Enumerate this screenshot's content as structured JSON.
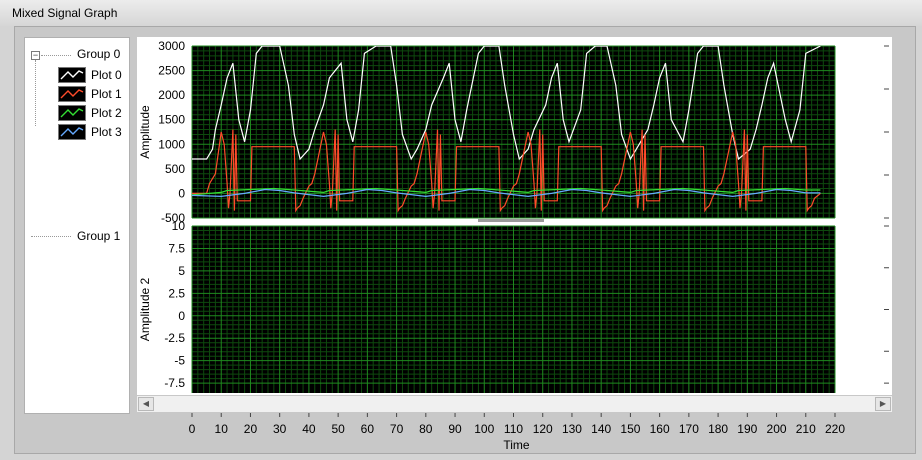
{
  "window": {
    "title": "Mixed Signal Graph"
  },
  "legend": {
    "expander_glyph": "−",
    "group0_label": "Group 0",
    "group1_label": "Group 1",
    "plots": [
      {
        "label": "Plot 0",
        "color": "#ffffff"
      },
      {
        "label": "Plot 1",
        "color": "#ff4b2a"
      },
      {
        "label": "Plot 2",
        "color": "#33dd33"
      },
      {
        "label": "Plot 3",
        "color": "#66aaff"
      }
    ]
  },
  "colors": {
    "plot_background": "#000000",
    "grid_major": "#1f8a1f",
    "grid_minor": "#0e4a0e"
  },
  "scrollbar": {
    "left_glyph": "◀",
    "right_glyph": "▶"
  },
  "chart_data": {
    "type": "line",
    "xlabel": "Time",
    "xlim": [
      0,
      220
    ],
    "xticks": [
      0,
      10,
      20,
      30,
      40,
      50,
      60,
      70,
      80,
      90,
      100,
      110,
      120,
      130,
      140,
      150,
      160,
      170,
      180,
      190,
      200,
      210,
      220
    ],
    "grid": true,
    "panels": [
      {
        "ylabel": "Amplitude",
        "ylim": [
          -500,
          3000
        ],
        "yticks": [
          3000,
          2500,
          2000,
          1500,
          1000,
          500,
          0,
          -500
        ],
        "period": 35,
        "series": [
          {
            "name": "Plot 0",
            "color": "#ffffff",
            "x": [
              0,
              5,
              7,
              8,
              10,
              12,
              14,
              16,
              18,
              20,
              22,
              24,
              28,
              30,
              33,
              35,
              37,
              40,
              42,
              45,
              47,
              51,
              53,
              55,
              57,
              59,
              63,
              65,
              68,
              70,
              72,
              75,
              77,
              80,
              82,
              86,
              88,
              90,
              92,
              94,
              98,
              100,
              103,
              105,
              107,
              110,
              112,
              115,
              117,
              121,
              123,
              125,
              127,
              129,
              133,
              135,
              138,
              140,
              142,
              145,
              147,
              150,
              152,
              156,
              158,
              160,
              162,
              164,
              168,
              170,
              173,
              175,
              177,
              180,
              182,
              185,
              187,
              191,
              193,
              195,
              197,
              199,
              203,
              205,
              208,
              210,
              215
            ],
            "y": [
              700,
              700,
              900,
              1300,
              1800,
              2350,
              2650,
              1500,
              1050,
              1700,
              2850,
              3000,
              3000,
              3000,
              2200,
              1200,
              700,
              900,
              1300,
              1800,
              2350,
              2650,
              1500,
              1050,
              1700,
              2850,
              3000,
              3000,
              3000,
              2200,
              1200,
              700,
              900,
              1300,
              1800,
              2350,
              2650,
              1500,
              1050,
              1700,
              2850,
              3000,
              3000,
              3000,
              2200,
              1200,
              700,
              900,
              1300,
              1800,
              2350,
              2650,
              1500,
              1050,
              1700,
              2850,
              3000,
              3000,
              3000,
              2200,
              1200,
              700,
              900,
              1300,
              1800,
              2350,
              2650,
              1500,
              1050,
              1700,
              2850,
              3000,
              3000,
              3000,
              2200,
              1200,
              700,
              900,
              1300,
              1800,
              2350,
              2650,
              1500,
              1050,
              1700,
              2850,
              3000,
              3000,
              3000,
              2200,
              1200,
              700,
              700
            ]
          },
          {
            "name": "Plot 1",
            "color": "#ff4b2a",
            "x": [
              0,
              5,
              6,
              8,
              10,
              11,
              12,
              12.5,
              13,
              14,
              14.5,
              15,
              15.5,
              20,
              20.5,
              35,
              35.5,
              36,
              37,
              38,
              40,
              41,
              42,
              45,
              46,
              47,
              47.5,
              48,
              49,
              49.5,
              50,
              50.5,
              55,
              55.5,
              70,
              70.5,
              71,
              72,
              73,
              75,
              76,
              77,
              80,
              81,
              82,
              82.5,
              83,
              84,
              84.5,
              85,
              85.5,
              90,
              90.5,
              105,
              105.5,
              106,
              107,
              108,
              110,
              111,
              112,
              115,
              116,
              117,
              117.5,
              118,
              119,
              119.5,
              120,
              120.5,
              125,
              125.5,
              140,
              140.5,
              141,
              142,
              143,
              145,
              146,
              147,
              150,
              151,
              152,
              152.5,
              153,
              154,
              154.5,
              155,
              155.5,
              160,
              160.5,
              175,
              175.5,
              176,
              177,
              178,
              180,
              181,
              182,
              185,
              186,
              187,
              187.5,
              188,
              189,
              189.5,
              190,
              190.5,
              195,
              195.5,
              210,
              210.5,
              211,
              212,
              213,
              215
            ],
            "y": [
              0,
              0,
              200,
              400,
              1250,
              1000,
              200,
              -300,
              0,
              1300,
              -350,
              1200,
              -150,
              -150,
              950,
              950,
              -350,
              -300,
              -250,
              -100,
              150,
              200,
              400,
              1250,
              1000,
              200,
              -300,
              0,
              1300,
              -350,
              1200,
              -150,
              -150,
              950,
              950,
              -350,
              -300,
              -250,
              -100,
              150,
              200,
              400,
              1250,
              1000,
              200,
              -300,
              0,
              1300,
              -350,
              1200,
              -150,
              -150,
              950,
              950,
              -350,
              -300,
              -250,
              -100,
              150,
              200,
              400,
              1250,
              1000,
              200,
              -300,
              0,
              1300,
              -350,
              1200,
              -150,
              -150,
              950,
              950,
              -350,
              -300,
              -250,
              -100,
              150,
              200,
              400,
              1250,
              1000,
              200,
              -300,
              0,
              1300,
              -350,
              1200,
              -150,
              -150,
              950,
              950,
              -350,
              -300,
              -250,
              -100,
              150,
              200,
              400,
              1250,
              1000,
              200,
              -300,
              0,
              1300,
              -350,
              1200,
              -150,
              -150,
              950,
              950,
              -350,
              -300,
              -250,
              -100,
              0
            ]
          },
          {
            "name": "Plot 2",
            "color": "#33dd33",
            "x": [
              0,
              10,
              12,
              20,
              28,
              35,
              45,
              47,
              55,
              63,
              70,
              80,
              82,
              90,
              98,
              105,
              115,
              117,
              125,
              133,
              140,
              150,
              152,
              160,
              168,
              175,
              185,
              187,
              195,
              203,
              210,
              215
            ],
            "y": [
              -30,
              20,
              60,
              80,
              100,
              70,
              20,
              60,
              80,
              100,
              70,
              20,
              60,
              80,
              100,
              70,
              20,
              60,
              80,
              100,
              70,
              20,
              60,
              80,
              100,
              70,
              20,
              60,
              80,
              100,
              70,
              70
            ]
          },
          {
            "name": "Plot 3",
            "color": "#66aaff",
            "x": [
              0,
              10,
              18,
              25,
              30,
              35,
              45,
              53,
              60,
              65,
              70,
              80,
              88,
              95,
              100,
              105,
              115,
              123,
              130,
              135,
              140,
              150,
              158,
              165,
              170,
              175,
              185,
              193,
              200,
              205,
              210,
              215
            ],
            "y": [
              -40,
              -60,
              0,
              80,
              60,
              10,
              -60,
              0,
              80,
              60,
              10,
              -60,
              0,
              80,
              60,
              10,
              -60,
              0,
              80,
              60,
              10,
              -60,
              0,
              80,
              60,
              10,
              -60,
              0,
              80,
              60,
              10,
              10
            ]
          }
        ]
      },
      {
        "ylabel": "Amplitude 2",
        "ylim": [
          -8.6,
          10
        ],
        "yticks": [
          10,
          7.5,
          5,
          2.5,
          0,
          -2.5,
          -5,
          -7.5
        ],
        "series": []
      }
    ]
  }
}
